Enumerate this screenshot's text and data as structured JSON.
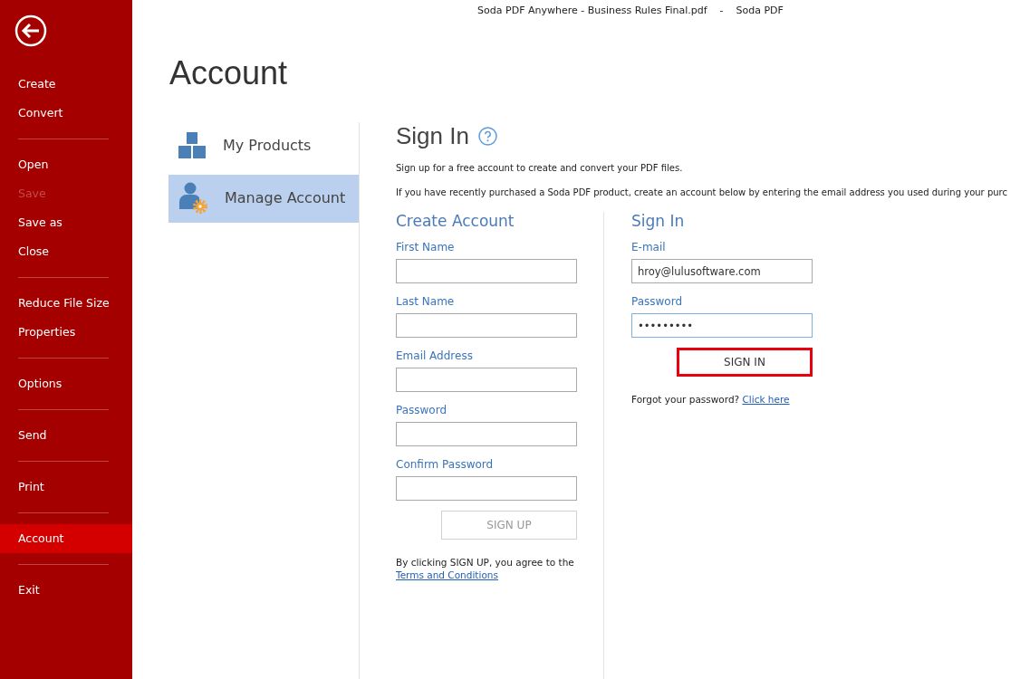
{
  "window": {
    "title": "Soda PDF Anywhere - Business Rules Final.pdf    -    Soda PDF"
  },
  "sidebar": {
    "groups": [
      [
        {
          "label": "Create",
          "disabled": false,
          "selected": false
        },
        {
          "label": "Convert",
          "disabled": false,
          "selected": false
        }
      ],
      [
        {
          "label": "Open",
          "disabled": false,
          "selected": false
        },
        {
          "label": "Save",
          "disabled": true,
          "selected": false
        },
        {
          "label": "Save as",
          "disabled": false,
          "selected": false
        },
        {
          "label": "Close",
          "disabled": false,
          "selected": false
        }
      ],
      [
        {
          "label": "Reduce File Size",
          "disabled": false,
          "selected": false
        },
        {
          "label": "Properties",
          "disabled": false,
          "selected": false
        }
      ],
      [
        {
          "label": "Options",
          "disabled": false,
          "selected": false
        }
      ],
      [
        {
          "label": "Send",
          "disabled": false,
          "selected": false
        }
      ],
      [
        {
          "label": "Print",
          "disabled": false,
          "selected": false
        }
      ],
      [
        {
          "label": "Account",
          "disabled": false,
          "selected": true
        }
      ],
      [
        {
          "label": "Exit",
          "disabled": false,
          "selected": false
        }
      ]
    ]
  },
  "page_title": "Account",
  "nav": [
    {
      "kind": "products",
      "label": "My Products",
      "selected": false
    },
    {
      "kind": "manage",
      "label": "Manage Account",
      "selected": true
    }
  ],
  "panel": {
    "title": "Sign In",
    "intro": "Sign up for a free account to create and convert your PDF files.",
    "note": "If you have recently purchased a Soda PDF product, create an account below by entering the email address you used during your purc"
  },
  "create_account": {
    "title": "Create Account",
    "fields": [
      {
        "label": "First Name",
        "focused": false
      },
      {
        "label": "Last Name",
        "focused": false
      },
      {
        "label": "Email Address",
        "focused": false
      },
      {
        "label": "Password",
        "focused": false
      },
      {
        "label": "Confirm Password",
        "focused": false
      }
    ],
    "button": {
      "label": "SIGN UP",
      "disabled": true,
      "highlighted": false
    },
    "terms_text": "By clicking SIGN UP, you agree to the",
    "terms_link": "Terms and Conditions"
  },
  "sign_in": {
    "title": "Sign In",
    "fields": [
      {
        "label": "E-mail",
        "value": "hroy@lulusoftware.com",
        "focused": false
      },
      {
        "label": "Password",
        "value": "•••••••••",
        "focused": true
      }
    ],
    "button": {
      "label": "SIGN IN",
      "disabled": false,
      "highlighted": true
    },
    "forgot_text": "Forgot your password?",
    "forgot_link": "Click here"
  }
}
